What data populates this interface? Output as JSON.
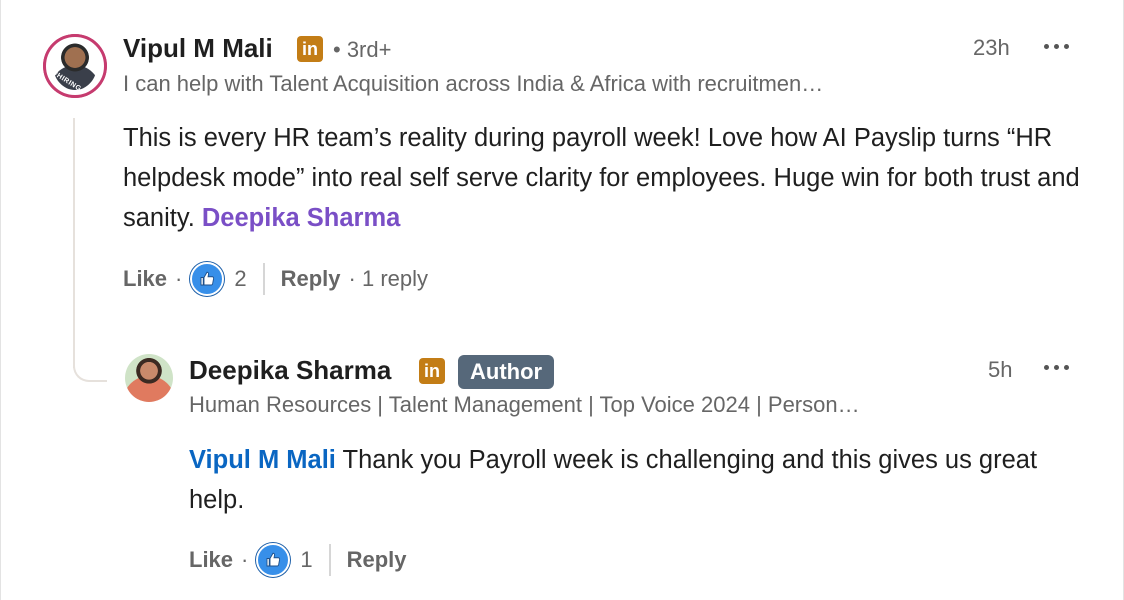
{
  "comment": {
    "author_name": "Vipul M Mali",
    "linkedin_badge": "in",
    "degree": "• 3rd+",
    "avatar_label": "#HIRING",
    "headline": "I can help with Talent Acquisition across India & Africa with recruitmen…",
    "time": "23h",
    "text_before_mention": "This is every HR team’s reality during payroll week! Love how AI Payslip turns “HR helpdesk mode” into real self serve clarity for employees. Huge win for both trust and sanity. ",
    "mention": "Deepika Sharma",
    "like_label": "Like",
    "dot": "·",
    "reaction_count": "2",
    "reply_label": "Reply",
    "reply_count_text": "· 1 reply"
  },
  "reply": {
    "author_name": "Deepika Sharma",
    "linkedin_badge": "in",
    "author_badge": "Author",
    "headline": "Human Resources | Talent Management | Top Voice 2024 | Person…",
    "time": "5h",
    "mention": "Vipul M Mali",
    "text_after_mention": " Thank you Payroll week is challenging and this gives us great help.",
    "like_label": "Like",
    "dot": "·",
    "reaction_count": "1",
    "reply_label": "Reply"
  },
  "colors": {
    "mention_purple": "#7a4fc6",
    "mention_blue": "#0a66c2",
    "linkedin_gold": "#c37d16",
    "author_badge_bg": "#56687a",
    "like_blue": "#378fe9"
  },
  "icons": {
    "more": "more-horizontal-icon",
    "like": "thumbs-up-like-icon",
    "linkedin": "linkedin-icon"
  }
}
